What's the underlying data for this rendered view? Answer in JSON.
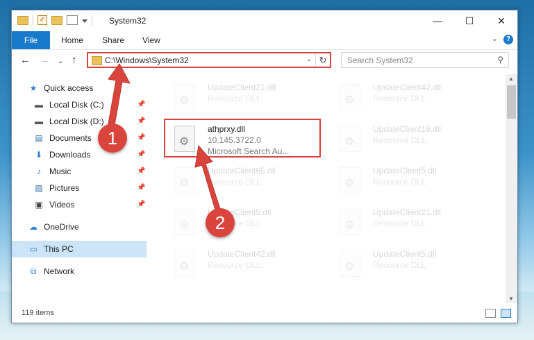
{
  "window": {
    "title": "System32",
    "controls": {
      "minimize": "—",
      "maximize": "☐",
      "close": "✕"
    }
  },
  "ribbon": {
    "tabs": [
      "File",
      "Home",
      "Share",
      "View"
    ],
    "help": "?"
  },
  "navbar": {
    "address": "C:\\Windows\\System32",
    "search_placeholder": "Search System32"
  },
  "sidebar": {
    "items": [
      {
        "label": "Quick access",
        "icon": "star-icon",
        "pinned": false
      },
      {
        "label": "Local Disk (C:)",
        "icon": "drive-icon",
        "pinned": true
      },
      {
        "label": "Local Disk (D:)",
        "icon": "drive-icon",
        "pinned": true
      },
      {
        "label": "Documents",
        "icon": "documents-icon",
        "pinned": true
      },
      {
        "label": "Downloads",
        "icon": "download-icon",
        "pinned": true
      },
      {
        "label": "Music",
        "icon": "music-icon",
        "pinned": true
      },
      {
        "label": "Pictures",
        "icon": "pictures-icon",
        "pinned": true
      },
      {
        "label": "Videos",
        "icon": "videos-icon",
        "pinned": true
      },
      {
        "label": "OneDrive",
        "icon": "cloud-icon",
        "pinned": false
      },
      {
        "label": "This PC",
        "icon": "computer-icon",
        "pinned": false,
        "selected": true
      },
      {
        "label": "Network",
        "icon": "network-icon",
        "pinned": false
      }
    ]
  },
  "files": {
    "left_column": [
      {
        "name": "UpdateClient21.dll",
        "sub1": "Resource DLL",
        "sub2": ""
      },
      {
        "name": "athprxy.dll",
        "sub1": "10.145.3722.0",
        "sub2": "Microsoft Search Au...",
        "highlighted": true
      },
      {
        "name": "UpdateClient65.dll",
        "sub1": "Resource DLL",
        "sub2": ""
      },
      {
        "name": "UpdateClient5.dll",
        "sub1": "Resource DLL",
        "sub2": ""
      },
      {
        "name": "UpdateClient42.dll",
        "sub1": "Resource DLL",
        "sub2": ""
      }
    ],
    "right_column": [
      {
        "name": "UpdateClient42.dll",
        "sub1": "Resource DLL"
      },
      {
        "name": "UpdateClient19.dll",
        "sub1": "Resource DLL"
      },
      {
        "name": "UpdateClient5.dll",
        "sub1": "Resource DLL"
      },
      {
        "name": "UpdateClient21.dll",
        "sub1": "Resource DLL"
      },
      {
        "name": "UpdateClient5.dll",
        "sub1": "Resource DLL"
      }
    ]
  },
  "status": {
    "item_count": "119 items"
  },
  "annotations": {
    "step1": "1",
    "step2": "2",
    "color": "#d9453c"
  }
}
